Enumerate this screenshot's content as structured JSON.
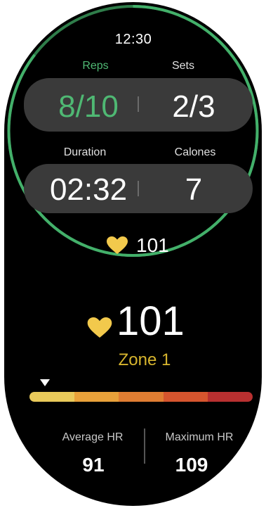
{
  "status": {
    "time": "12:30"
  },
  "workout": {
    "reps_label": "Reps",
    "reps_value": "8/10",
    "sets_label": "Sets",
    "sets_value": "2/3",
    "duration_label": "Duration",
    "duration_value": "02:32",
    "calories_label": "Calones",
    "calories_value": "7",
    "heart_rate_small": "101"
  },
  "heart_rate": {
    "value": "101",
    "zone": "Zone 1",
    "zone_colors": [
      "#e8c95a",
      "#e8a13a",
      "#e07d32",
      "#d6552e",
      "#b83030"
    ],
    "marker_position": 0.07,
    "average_label": "Average HR",
    "average_value": "91",
    "maximum_label": "Maximum HR",
    "maximum_value": "109"
  },
  "colors": {
    "accent_green": "#4fb873",
    "heart_yellow": "#f2c94c",
    "zone_text": "#d7b52e"
  },
  "icons": {
    "heart_small": "heart-icon",
    "heart_big": "heart-icon",
    "zone_marker": "triangle-marker-icon"
  }
}
